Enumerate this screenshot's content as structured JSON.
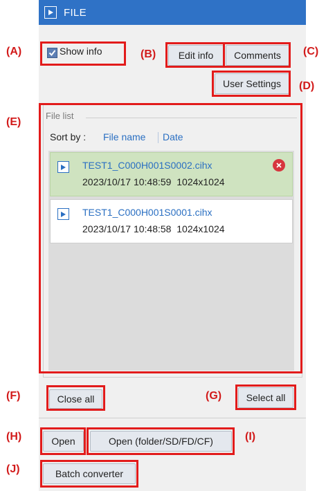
{
  "title": "FILE",
  "annotations": {
    "A": "(A)",
    "B": "(B)",
    "C": "(C)",
    "D": "(D)",
    "E": "(E)",
    "F": "(F)",
    "G": "(G)",
    "H": "(H)",
    "I": "(I)",
    "J": "(J)"
  },
  "show_info": {
    "label": "Show info",
    "checked": true
  },
  "buttons": {
    "edit_info": "Edit info",
    "comments": "Comments",
    "user_settings": "User Settings",
    "close_all": "Close all",
    "select_all": "Select all",
    "open": "Open",
    "open_folder": "Open (folder/SD/FD/CF)",
    "batch_converter": "Batch converter"
  },
  "file_list": {
    "title": "File list",
    "sort_by_label": "Sort by :",
    "sort_options": [
      "File name",
      "Date"
    ],
    "items": [
      {
        "name": "TEST1_C000H001S0002.cihx",
        "datetime": "2023/10/17 10:48:59",
        "resolution": "1024x1024",
        "selected": true
      },
      {
        "name": "TEST1_C000H001S0001.cihx",
        "datetime": "2023/10/17 10:48:58",
        "resolution": "1024x1024",
        "selected": false
      }
    ]
  },
  "colors": {
    "title_bar": "#2f72c6",
    "highlight": "#e21b1b",
    "link": "#2a6fc2",
    "selected_item": "#cfe3c0",
    "remove": "#d7353e"
  }
}
